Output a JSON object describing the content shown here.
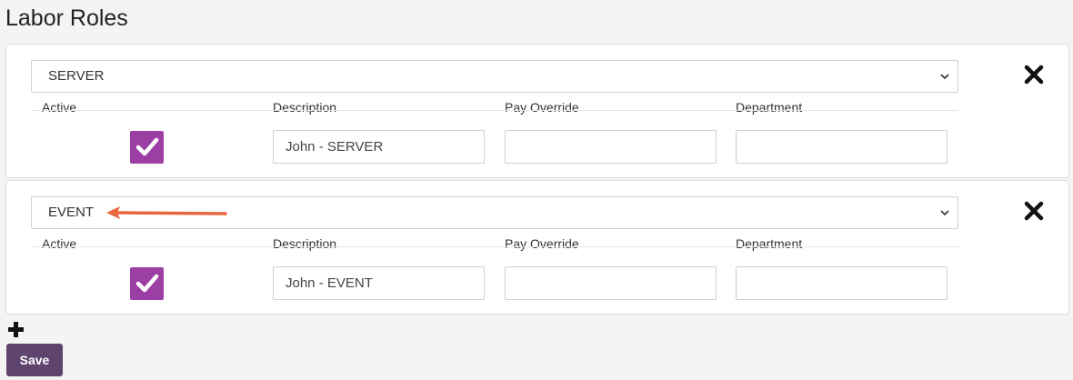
{
  "page": {
    "title": "Labor Roles"
  },
  "headers": {
    "active": "Active",
    "description": "Description",
    "pay_override": "Pay Override",
    "department": "Department"
  },
  "roles": [
    {
      "role": "SERVER",
      "active": true,
      "description": "John - SERVER",
      "pay_override": "",
      "department": ""
    },
    {
      "role": "EVENT",
      "active": true,
      "description": "John - EVENT",
      "pay_override": "",
      "department": ""
    }
  ],
  "actions": {
    "save_label": "Save"
  },
  "icons": {
    "remove": "close-icon",
    "add": "plus-icon",
    "dropdown": "chevron-down-icon",
    "check": "checkmark-icon"
  },
  "colors": {
    "checkbox": "#9c3fa4",
    "save_button": "#5f4470",
    "annotation_arrow": "#e8673c"
  }
}
